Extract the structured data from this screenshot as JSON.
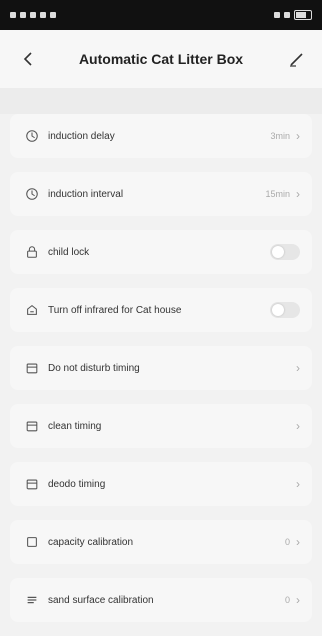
{
  "header": {
    "title": "Automatic Cat Litter Box"
  },
  "rows": [
    {
      "label": "induction delay",
      "value": "3min",
      "icon": "clock-icon",
      "control": "chevron"
    },
    {
      "label": "induction interval",
      "value": "15min",
      "icon": "clock-icon",
      "control": "chevron"
    },
    {
      "label": "child lock",
      "value": "",
      "icon": "lock-icon",
      "control": "toggle",
      "state": "off"
    },
    {
      "label": "Turn off infrared for Cat house",
      "value": "",
      "icon": "house-icon",
      "control": "toggle",
      "state": "off"
    },
    {
      "label": "Do not disturb timing",
      "value": "",
      "icon": "calendar-icon",
      "control": "chevron"
    },
    {
      "label": "clean timing",
      "value": "",
      "icon": "calendar-icon",
      "control": "chevron"
    },
    {
      "label": "deodo timing",
      "value": "",
      "icon": "calendar-icon",
      "control": "chevron"
    },
    {
      "label": "capacity calibration",
      "value": "0",
      "icon": "box-icon",
      "control": "chevron"
    },
    {
      "label": "sand surface calibration",
      "value": "0",
      "icon": "layers-icon",
      "control": "chevron"
    }
  ]
}
